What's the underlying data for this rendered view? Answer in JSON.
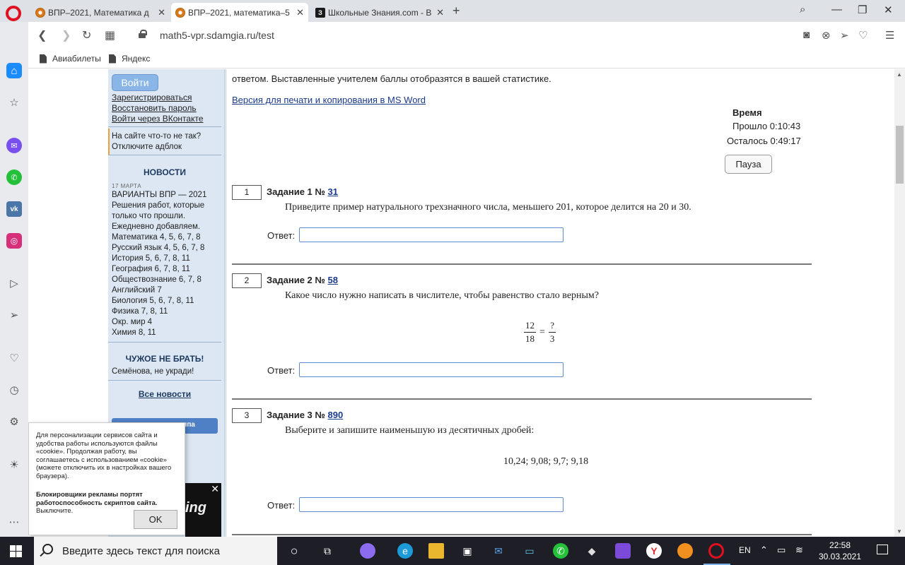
{
  "browser": {
    "tabs": [
      {
        "title": "ВПР–2021, Математика д",
        "active": false
      },
      {
        "title": "ВПР–2021, математика–5",
        "active": true
      },
      {
        "title": "Школьные Знания.com - В",
        "active": false
      }
    ],
    "url": "math5-vpr.sdamgia.ru/test",
    "bookmarks": [
      "Авиабилеты",
      "Яндекс"
    ]
  },
  "sidebar": {
    "login_button": "Войти",
    "auth_links": [
      "Зарегистрироваться",
      "Восстановить пароль",
      "Войти через ВКонтакте"
    ],
    "notice_lines": [
      "На сайте что-то не так?",
      "Отключите адблок"
    ],
    "news_heading": "НОВОСТИ",
    "news_date": "17 МАРТА",
    "news_lines": [
      "ВАРИАНТЫ ВПР — 2021",
      "Решения работ, которые",
      "только что прошли.",
      "Ежедневно добавляем.",
      "Математика 4, 5, 6, 7, 8",
      "Русский язык 4, 5, 6, 7, 8",
      "История 5, 6, 7, 8, 11",
      "География 6, 7, 8, 11",
      "Обществознание 6, 7, 8",
      "Английский 7",
      "Биология 5, 6, 7, 8, 11",
      "Физика 7, 8, 11",
      "Окр. мир 4",
      "Химия 8, 11"
    ],
    "warning_heading": "ЧУЖОЕ НЕ БРАТЬ!",
    "warning_text": "Семёнова, не укради!",
    "all_news_link": "Все новости",
    "blue_button_fragment": "ппа"
  },
  "cookie_popup": {
    "text": "Для персонализации сервисов сайта и удобства работы используются файлы «cookie». Продолжая работу, вы соглашаетесь с использованием «cookie» (можете отключить их в настройках вашего браузера).",
    "bold_text": "Блокировщики рекламы портят работоспособность скриптов сайта.",
    "bold_suffix": "Выключите.",
    "ok_label": "OK"
  },
  "ad": {
    "word": "ing"
  },
  "main": {
    "intro_text": "ответом. Выставленные учителем баллы отобразятся в вашей статистике.",
    "print_link": "Версия для печати и копирования в MS Word",
    "timer": {
      "title": "Время",
      "elapsed": "Прошло 0:10:43",
      "remaining": "Осталось 0:49:17",
      "pause_label": "Пауза"
    },
    "answer_label": "Ответ:",
    "tasks": [
      {
        "index": "1",
        "title": "Задание 1 №",
        "number": "31",
        "text": "Приведите пример натурального трехзначного числа, меньшего 201, которое делится на 20 и 30."
      },
      {
        "index": "2",
        "title": "Задание 2 №",
        "number": "58",
        "text": "Какое число нужно написать в числителе, чтобы равенство стало верным?",
        "fraction": {
          "left_num": "12",
          "left_den": "18",
          "eq": "=",
          "right_num": "?",
          "right_den": "3"
        }
      },
      {
        "index": "3",
        "title": "Задание 3 №",
        "number": "890",
        "text": "Выберите и запишите наименьшую из десятичных дробей:",
        "values": "10,24; 9,08; 9,7; 9,18"
      }
    ]
  },
  "taskbar": {
    "search_placeholder": "Введите здесь текст для поиска",
    "lang": "EN",
    "time": "22:58",
    "date": "30.03.2021"
  }
}
